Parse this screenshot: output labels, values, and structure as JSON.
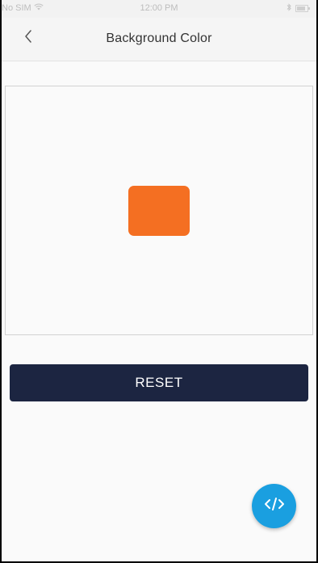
{
  "status_bar": {
    "carrier": "No SIM",
    "time": "12:00 PM"
  },
  "header": {
    "title": "Background Color"
  },
  "preview": {
    "swatch_color": "#f46f22"
  },
  "actions": {
    "reset_label": "RESET"
  },
  "colors": {
    "accent": "#1c2541",
    "fab": "#1a9fe0"
  },
  "fab": {
    "icon": "code-icon"
  }
}
